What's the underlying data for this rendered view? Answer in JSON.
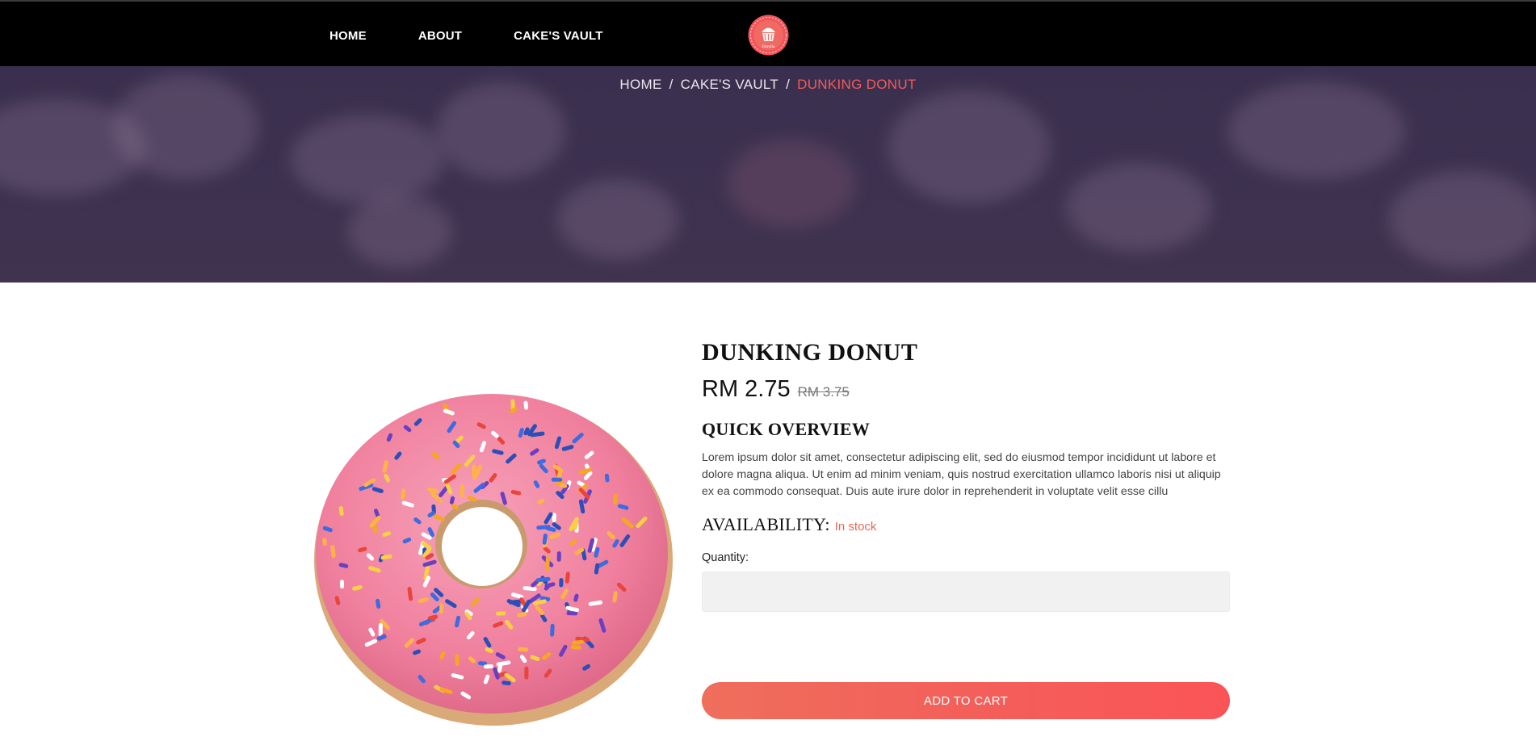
{
  "nav": {
    "links": [
      "HOME",
      "ABOUT",
      "CAKE'S VAULT"
    ],
    "logo_text": "Dorolla"
  },
  "breadcrumb": {
    "items": [
      "HOME",
      "CAKE'S VAULT"
    ],
    "current": "DUNKING DONUT",
    "separator": "/"
  },
  "product": {
    "title": "DUNKING DONUT",
    "price": "RM 2.75",
    "old_price": "RM 3.75",
    "overview_heading": "QUICK OVERVIEW",
    "description": "Lorem ipsum dolor sit amet, consectetur adipiscing elit, sed do eiusmod tempor incididunt ut labore et dolore magna aliqua. Ut enim ad minim veniam, quis nostrud exercitation ullamco laboris nisi ut aliquip ex ea commodo consequat. Duis aute irure dolor in reprehenderit in voluptate velit esse cillu",
    "availability_label": "AVAILABILITY:",
    "availability_value": "In stock",
    "quantity_label": "Quantity:",
    "quantity_value": "",
    "add_to_cart": "ADD TO CART"
  },
  "colors": {
    "accent": "#f45a5a",
    "navbar": "#000000",
    "hero_overlay": "#3b3050",
    "stock": "#e9694f"
  },
  "icons": {
    "logo": "cupcake-badge-icon"
  }
}
